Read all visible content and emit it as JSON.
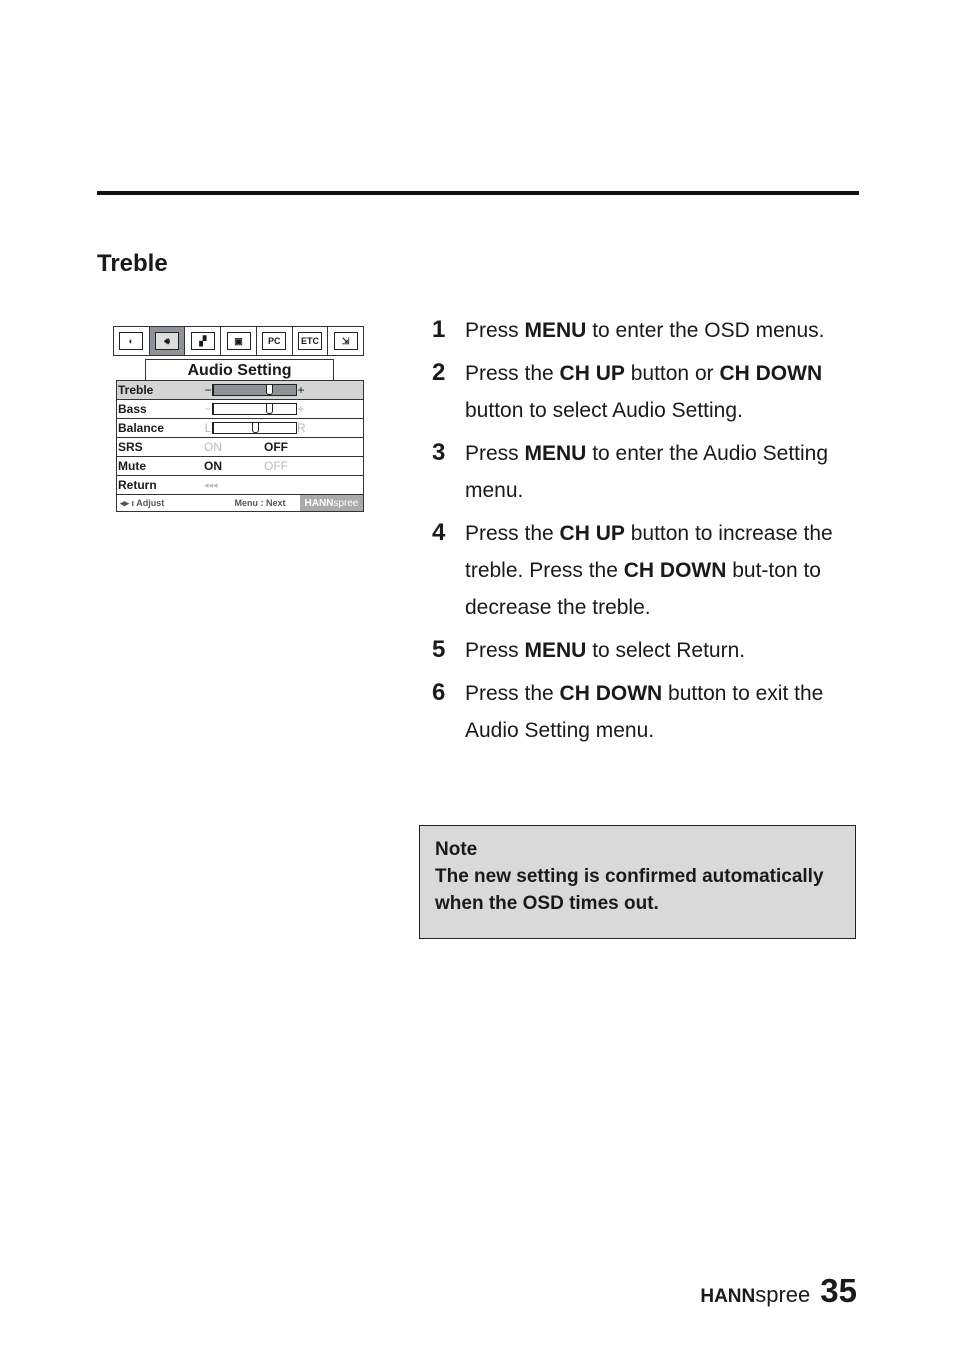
{
  "section": {
    "title": "Treble"
  },
  "osd": {
    "tabs": [
      {
        "icon": "brightness-icon",
        "glyph": "◐",
        "active": false
      },
      {
        "icon": "speaker-icon",
        "glyph": "🔊︎",
        "active": true
      },
      {
        "icon": "picture-icon",
        "glyph": "▞",
        "active": false
      },
      {
        "icon": "tv-icon",
        "glyph": "▣",
        "active": false
      },
      {
        "icon": "pc-icon",
        "glyph": "PC",
        "active": false
      },
      {
        "icon": "etc-icon",
        "glyph": "ETC",
        "active": false
      },
      {
        "icon": "exit-icon",
        "glyph": "⇲",
        "active": false
      }
    ],
    "title": "Audio Setting",
    "rows": {
      "treble": {
        "label": "Treble",
        "minus": "−",
        "plus": "+",
        "value_fraction": 0.67
      },
      "bass": {
        "label": "Bass",
        "minus": "−",
        "plus": "+",
        "value_fraction": 0.67
      },
      "balance": {
        "label": "Balance",
        "left": "L",
        "right": "R",
        "value_fraction": 0.5
      },
      "srs": {
        "label": "SRS",
        "on": "ON",
        "off": "OFF",
        "selected": "OFF"
      },
      "mute": {
        "label": "Mute",
        "on": "ON",
        "off": "OFF",
        "selected": "ON"
      },
      "return": {
        "label": "Return",
        "glyph": "◂◂◂"
      }
    },
    "footer": {
      "adjust": "◂▸ ı Adjust",
      "next": "Menu : Next",
      "brand_bold": "HANN",
      "brand_light": "spree"
    }
  },
  "steps": [
    {
      "num": "1",
      "parts": [
        [
          "Press ",
          false
        ],
        [
          "MENU",
          true
        ],
        [
          " to enter the OSD menus.",
          false
        ]
      ]
    },
    {
      "num": "2",
      "parts": [
        [
          "Press the ",
          false
        ],
        [
          "CH UP",
          true
        ],
        [
          " button or ",
          false
        ],
        [
          "CH DOWN",
          true
        ],
        [
          " button to select Audio Setting.",
          false
        ]
      ]
    },
    {
      "num": "3",
      "parts": [
        [
          "Press ",
          false
        ],
        [
          "MENU",
          true
        ],
        [
          " to enter the Audio Setting menu.",
          false
        ]
      ]
    },
    {
      "num": "4",
      "parts": [
        [
          "Press the ",
          false
        ],
        [
          "CH UP",
          true
        ],
        [
          " button to increase the treble. Press the ",
          false
        ],
        [
          "CH DOWN",
          true
        ],
        [
          " but-ton to decrease the treble.",
          false
        ]
      ]
    },
    {
      "num": "5",
      "parts": [
        [
          "Press ",
          false
        ],
        [
          "MENU",
          true
        ],
        [
          " to select Return.",
          false
        ]
      ]
    },
    {
      "num": "6",
      "parts": [
        [
          "Press the ",
          false
        ],
        [
          "CH DOWN",
          true
        ],
        [
          " button to exit the Audio Setting menu.",
          false
        ]
      ]
    }
  ],
  "note": {
    "heading": "Note",
    "body": "The new setting is confirmed automatically when the OSD times out."
  },
  "footer": {
    "brand_bold": "HANN",
    "brand_light": "spree",
    "page_number": "35"
  }
}
